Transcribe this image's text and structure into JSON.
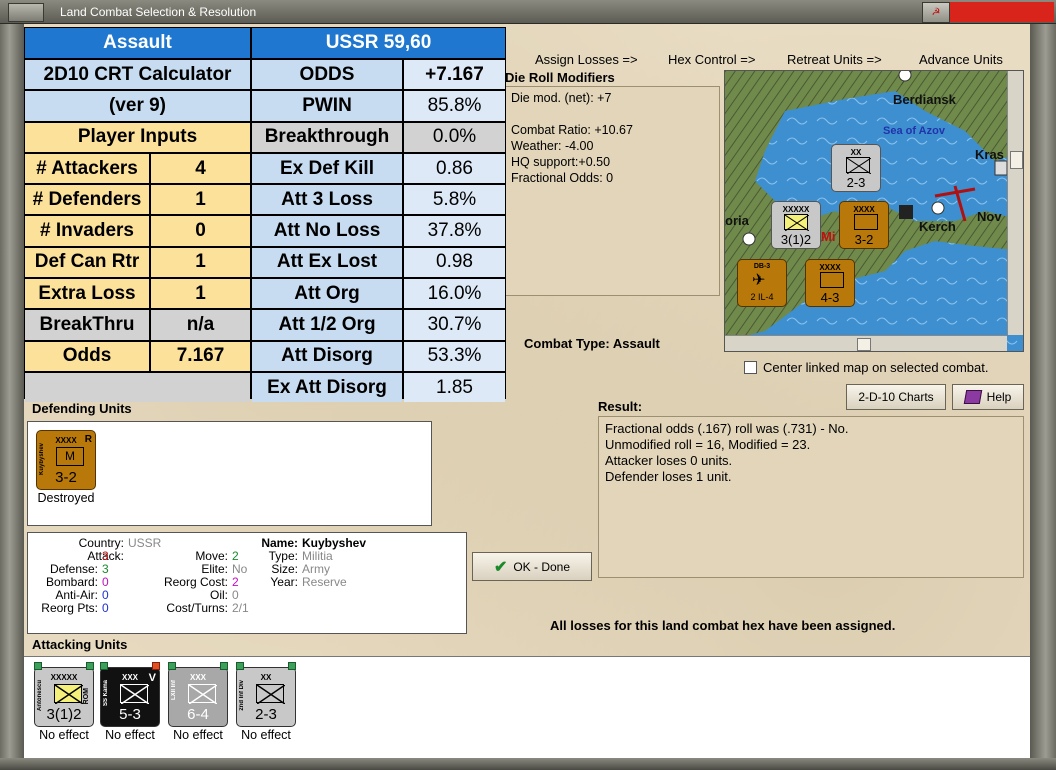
{
  "window": {
    "title": "Land Combat Selection & Resolution"
  },
  "crt": {
    "rows": [
      [
        {
          "t": "Assault",
          "c": "hdr",
          "s": 2
        },
        {
          "t": "USSR 59,60",
          "c": "hdr",
          "s": 2
        }
      ],
      [
        {
          "t": "2D10 CRT Calculator",
          "c": "lt bld",
          "s": 2
        },
        {
          "t": "ODDS",
          "c": "lt bld"
        },
        {
          "t": "+7.167",
          "c": "vb bld"
        }
      ],
      [
        {
          "t": "(ver 9)",
          "c": "lt bld",
          "s": 2
        },
        {
          "t": "PWIN",
          "c": "lt bld"
        },
        {
          "t": "85.8%",
          "c": "vb"
        }
      ],
      [
        {
          "t": "Player Inputs",
          "c": "yl bld",
          "s": 2
        },
        {
          "t": "Breakthrough",
          "c": "gr bld"
        },
        {
          "t": "0.0%",
          "c": "gr"
        }
      ],
      [
        {
          "t": "# Attackers",
          "c": "yl bld"
        },
        {
          "t": "4",
          "c": "yl bld"
        },
        {
          "t": "Ex Def Kill",
          "c": "lt bld"
        },
        {
          "t": "0.86",
          "c": "vb"
        }
      ],
      [
        {
          "t": "# Defenders",
          "c": "yl bld"
        },
        {
          "t": "1",
          "c": "yl bld"
        },
        {
          "t": "Att 3 Loss",
          "c": "lt bld"
        },
        {
          "t": "5.8%",
          "c": "vb"
        }
      ],
      [
        {
          "t": "# Invaders",
          "c": "yl bld"
        },
        {
          "t": "0",
          "c": "yl bld"
        },
        {
          "t": "Att No Loss",
          "c": "lt bld"
        },
        {
          "t": "37.8%",
          "c": "vb"
        }
      ],
      [
        {
          "t": "Def Can Rtr",
          "c": "yl bld"
        },
        {
          "t": "1",
          "c": "yl bld"
        },
        {
          "t": "Att Ex Lost",
          "c": "lt bld"
        },
        {
          "t": "0.98",
          "c": "vb"
        }
      ],
      [
        {
          "t": "Extra Loss",
          "c": "yl bld"
        },
        {
          "t": "1",
          "c": "yl bld"
        },
        {
          "t": "Att Org",
          "c": "lt bld"
        },
        {
          "t": "16.0%",
          "c": "vb"
        }
      ],
      [
        {
          "t": "BreakThru",
          "c": "gr bld"
        },
        {
          "t": "n/a",
          "c": "gr bld"
        },
        {
          "t": "Att 1/2 Org",
          "c": "lt bld"
        },
        {
          "t": "30.7%",
          "c": "vb"
        }
      ],
      [
        {
          "t": "Odds",
          "c": "yl bld"
        },
        {
          "t": "7.167",
          "c": "yl bld"
        },
        {
          "t": "Att Disorg",
          "c": "lt bld"
        },
        {
          "t": "53.3%",
          "c": "vb"
        }
      ],
      [
        {
          "t": "",
          "c": "gr",
          "s": 2
        },
        {
          "t": "Ex Att Disorg",
          "c": "lt bld"
        },
        {
          "t": "1.85",
          "c": "vb"
        }
      ]
    ]
  },
  "tabs": [
    "Assign Losses =>",
    "Hex Control =>",
    "Retreat Units =>",
    "Advance Units"
  ],
  "die_roll": {
    "title": "Die Roll Modifiers",
    "lines": [
      "Die mod. (net): +7",
      "",
      "Combat Ratio: +10.67",
      "Weather: -4.00",
      "HQ support:+0.50",
      "Fractional Odds: 0"
    ]
  },
  "map": {
    "labels": {
      "berdiansk": "Berdiansk",
      "sea": "Sea of Azov",
      "kras": "Kras",
      "oria": "oria",
      "kerch": "Kerch",
      "nov": "Nov",
      "mi": "Mi"
    },
    "units": [
      {
        "id": "a",
        "size": "XX",
        "str": "2-3",
        "name": "2nd Inf Div",
        "color": "#c8c8c8",
        "num": "2"
      },
      {
        "id": "b",
        "size": "XXXXX",
        "str": "3(1)2",
        "name": "Antonescu",
        "color": "#c8c8c8",
        "num": "2"
      },
      {
        "id": "c",
        "size": "XXXX",
        "str": "3-2",
        "name": "Kuybyshev",
        "color": "#b8780a"
      },
      {
        "id": "d",
        "size": "",
        "str": "2  IL-4",
        "name": "DB-3",
        "color": "#b8780a",
        "num": "5"
      },
      {
        "id": "e",
        "size": "XXXX",
        "str": "4-3",
        "name": "Crimea",
        "color": "#b8780a"
      }
    ]
  },
  "combat_type": {
    "label": "Combat Type:",
    "value": "Assault"
  },
  "center_link": "Center linked map on selected combat.",
  "charts_button": "2-D-10 Charts",
  "help_button": "Help",
  "result": {
    "title": "Result:",
    "lines": [
      "Fractional odds (.167) roll was (.731)  - No.",
      "Unmodified roll = 16, Modified = 23.",
      "Attacker loses 0 units.",
      "Defender loses 1 unit."
    ]
  },
  "defending": {
    "title": "Defending Units",
    "unit": {
      "size": "XXXX",
      "flag": "R",
      "name": "Kuybyshev",
      "str": "3-2",
      "status": "Destroyed"
    }
  },
  "info": {
    "country": {
      "label": "Country:",
      "value": "USSR"
    },
    "attack": {
      "label": "Attack:",
      "value": "3"
    },
    "defense": {
      "label": "Defense:",
      "value": "3"
    },
    "bombard": {
      "label": "Bombard:",
      "value": "0"
    },
    "anti_air": {
      "label": "Anti-Air:",
      "value": "0"
    },
    "reorg_pts": {
      "label": "Reorg Pts:",
      "value": "0"
    },
    "move": {
      "label": "Move:",
      "value": "2"
    },
    "elite": {
      "label": "Elite:",
      "value": "No"
    },
    "reorg_cost": {
      "label": "Reorg Cost:",
      "value": "2"
    },
    "oil": {
      "label": "Oil:",
      "value": "0"
    },
    "cost_turns": {
      "label": "Cost/Turns:",
      "value": "2/1"
    },
    "name": {
      "label": "Name:",
      "value": "Kuybyshev"
    },
    "type": {
      "label": "Type:",
      "value": "Militia"
    },
    "size": {
      "label": "Size:",
      "value": "Army"
    },
    "year": {
      "label": "Year:",
      "value": "Reserve"
    }
  },
  "ok_button": "OK - Done",
  "all_losses": "All losses for this land combat hex have been assigned.",
  "attacking": {
    "title": "Attacking Units",
    "units": [
      {
        "size": "XXXXX",
        "name": "Antonescu",
        "str": "3(1)2",
        "tag": "ROM",
        "status": "No effect",
        "bg": "#c8c8c8",
        "sym": "#f4f07a",
        "fg": "#000"
      },
      {
        "size": "XXX",
        "name": "SS Kama",
        "str": "5-3",
        "tag": "V",
        "status": "No effect",
        "bg": "#111111",
        "sym": "#111111",
        "fg": "#fff"
      },
      {
        "size": "XXX",
        "name": "LXII Inf",
        "str": "6-4",
        "tag": "",
        "status": "No effect",
        "bg": "#a8a8a8",
        "sym": "#a8a8a8",
        "fg": "#fff"
      },
      {
        "size": "XX",
        "name": "2nd Inf Div",
        "str": "2-3",
        "tag": "",
        "status": "No effect",
        "bg": "#c8c8c8",
        "sym": "#c8c8c8",
        "fg": "#000"
      }
    ]
  },
  "colors": {
    "accent": "#1f77d0",
    "parchment": "#e8dcc3",
    "attack_red": "#d01010",
    "defense_green": "#1a8a2a",
    "anti_air_blue": "#2030d0",
    "bombard_purple": "#c010c0"
  }
}
